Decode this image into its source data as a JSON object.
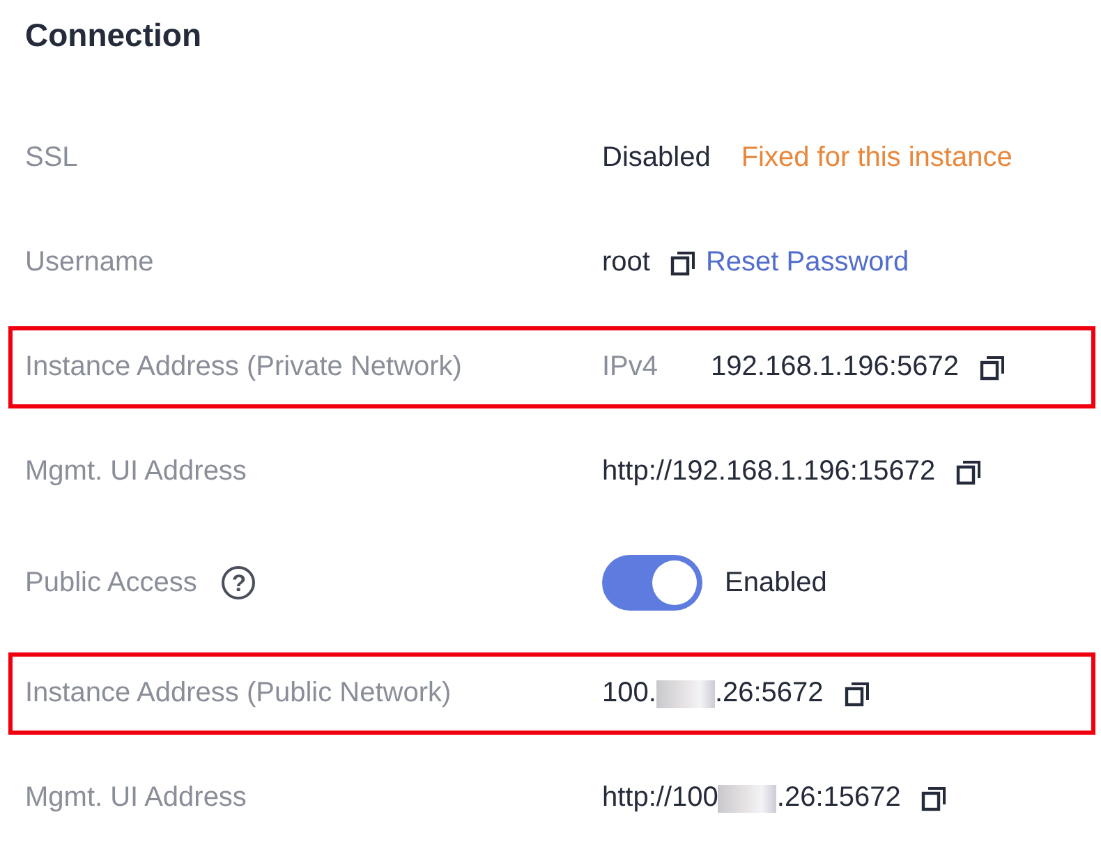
{
  "title": "Connection",
  "rows": [
    {
      "label": "SSL",
      "highlighted": false,
      "values": [
        {
          "kind": "text",
          "text": "Disabled"
        },
        {
          "kind": "note",
          "text": "Fixed for this instance"
        }
      ]
    },
    {
      "label": "Username",
      "highlighted": false,
      "values": [
        {
          "kind": "text",
          "text": "root"
        },
        {
          "kind": "copy"
        },
        {
          "kind": "link",
          "text": "Reset Password"
        }
      ]
    },
    {
      "label": "Instance Address (Private Network)",
      "highlighted": true,
      "values": [
        {
          "kind": "tag",
          "text": "IPv4"
        },
        {
          "kind": "text",
          "text": "192.168.1.196:5672"
        },
        {
          "kind": "copy"
        }
      ]
    },
    {
      "label": "Mgmt. UI Address",
      "highlighted": false,
      "values": [
        {
          "kind": "text",
          "text": "http://192.168.1.196:15672"
        },
        {
          "kind": "copy"
        }
      ]
    },
    {
      "label": "Public Access",
      "help": "?",
      "highlighted": false,
      "values": [
        {
          "kind": "switch",
          "on": true
        },
        {
          "kind": "text",
          "text": "Enabled"
        }
      ]
    },
    {
      "label": "Instance Address (Public Network)",
      "highlighted": true,
      "values": [
        {
          "kind": "text",
          "text": "100."
        },
        {
          "kind": "redacted"
        },
        {
          "kind": "text",
          "text": ".26:5672"
        },
        {
          "kind": "copy"
        }
      ]
    },
    {
      "label": "Mgmt. UI Address",
      "highlighted": false,
      "values": [
        {
          "kind": "text",
          "text": "http://100"
        },
        {
          "kind": "redacted"
        },
        {
          "kind": "text",
          "text": ".26:15672"
        },
        {
          "kind": "copy"
        }
      ]
    }
  ]
}
